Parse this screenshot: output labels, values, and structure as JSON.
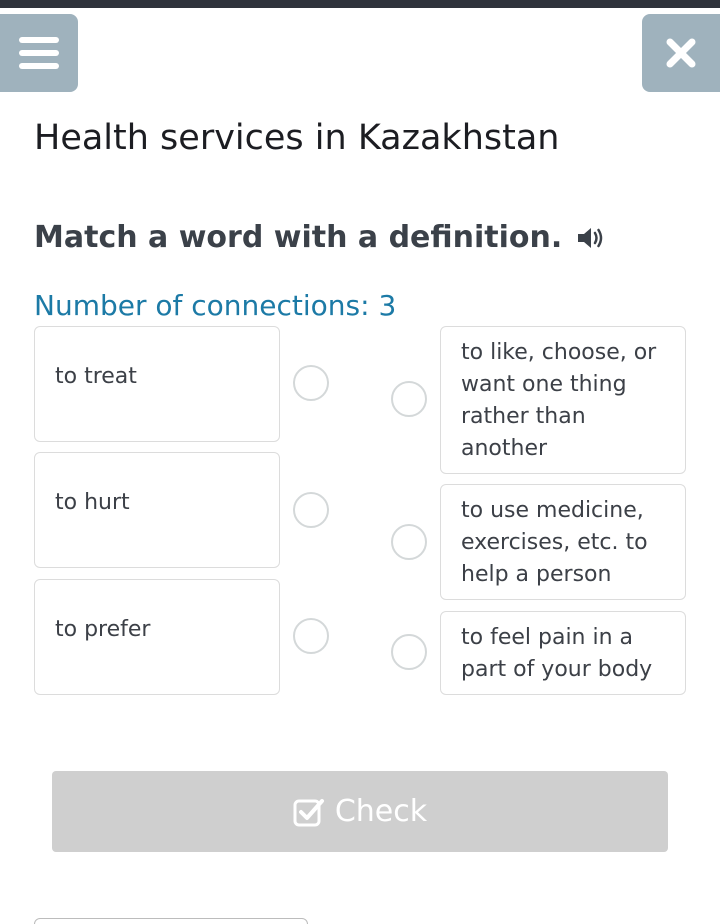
{
  "header": {
    "menu_icon": "hamburger-icon",
    "close_icon": "close-icon"
  },
  "page_title": "Health services in Kazakhstan",
  "instruction": {
    "text": "Match a word with a definition.",
    "audio_icon": "speaker-icon"
  },
  "connections_label": "Number of connections: 3",
  "words": [
    {
      "label": "to treat"
    },
    {
      "label": "to hurt"
    },
    {
      "label": "to prefer"
    }
  ],
  "definitions": [
    {
      "label": "to like, choose, or want one thing rather than another"
    },
    {
      "label": "to use medicine, exercises, etc. to help a person"
    },
    {
      "label": "to feel pain in a part of your body"
    }
  ],
  "check_button": {
    "label": "Check",
    "icon": "checkbox-icon"
  },
  "colors": {
    "header_button": "#9fb2bd",
    "accent": "#1c7aa6",
    "check_disabled": "#cfcfcf"
  }
}
